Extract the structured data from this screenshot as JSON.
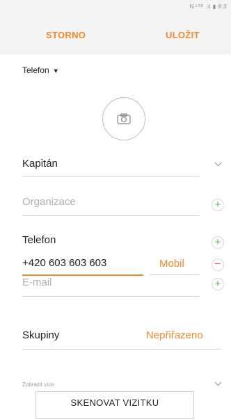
{
  "status_bar": {
    "text": "N ᴸᵀᴱ .ıl ▮ 9:3"
  },
  "toolbar": {
    "cancel_label": "STORNO",
    "save_label": "ULOŽIT"
  },
  "account": {
    "label": "Telefon"
  },
  "name": {
    "value": "Kapitán"
  },
  "organization": {
    "placeholder": "Organizace"
  },
  "phone": {
    "section_label": "Telefon",
    "value": "+420 603 603 603",
    "type_label": "Mobil"
  },
  "email": {
    "placeholder": "E-mail"
  },
  "groups": {
    "label": "Skupiny",
    "value": "Nepřiřazeno"
  },
  "more": {
    "label": "Zobrazit více"
  },
  "scan_button": {
    "label": "SKENOVAT VIZITKU"
  },
  "icons": [
    "camera-icon",
    "chevron-down-icon",
    "plus-icon",
    "minus-icon",
    "dropdown-caret-icon"
  ],
  "colors": {
    "accent": "#ee8a2a",
    "add": "#5cb85c",
    "remove": "#e06a6a",
    "toolbar_bg": "#f4f4f4"
  }
}
